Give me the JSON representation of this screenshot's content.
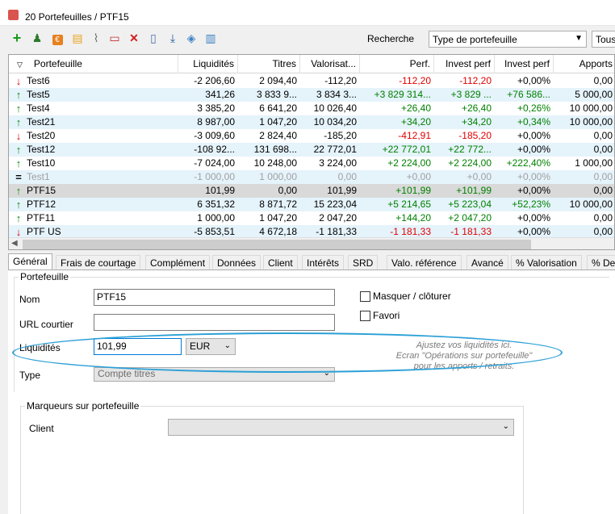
{
  "window": {
    "title": "20 Portefeuilles / PTF15"
  },
  "toolbar": {
    "icons": [
      "add-icon",
      "portfolio-icon",
      "currency-icon",
      "notes-icon",
      "paperclip-icon",
      "calendar-icon",
      "delete-icon",
      "document-icon",
      "download-icon",
      "bag-icon",
      "clipboard-icon"
    ],
    "search_label": "Recherche",
    "type_select": "Type de portefeuille",
    "tous_select": "Tous"
  },
  "grid": {
    "columns": [
      "Portefeuille",
      "Liquidités",
      "Titres",
      "Valorisat...",
      "Perf.",
      "Invest perf",
      "Invest perf",
      "Apports"
    ],
    "rows": [
      {
        "trend": "down",
        "name": "Test6",
        "cells": [
          "-2 206,60",
          "2 094,40",
          "-112,20",
          "-112,20",
          "-112,20",
          "+0,00%",
          "0,00"
        ],
        "colors": [
          "",
          "",
          "",
          "neg",
          "neg",
          "",
          ""
        ]
      },
      {
        "trend": "up",
        "name": "Test5",
        "cells": [
          "341,26",
          "3 833 9...",
          "3 834 3...",
          "+3 829 314...",
          "+3 829 ...",
          "+76 586...",
          "5 000,00"
        ],
        "colors": [
          "",
          "",
          "",
          "pos",
          "pos",
          "pos",
          ""
        ]
      },
      {
        "trend": "up",
        "name": "Test4",
        "cells": [
          "3 385,20",
          "6 641,20",
          "10 026,40",
          "+26,40",
          "+26,40",
          "+0,26%",
          "10 000,00"
        ],
        "colors": [
          "",
          "",
          "",
          "pos",
          "pos",
          "pos",
          ""
        ]
      },
      {
        "trend": "up",
        "name": "Test21",
        "cells": [
          "8 987,00",
          "1 047,20",
          "10 034,20",
          "+34,20",
          "+34,20",
          "+0,34%",
          "10 000,00"
        ],
        "colors": [
          "",
          "",
          "",
          "pos",
          "pos",
          "pos",
          ""
        ]
      },
      {
        "trend": "down",
        "name": "Test20",
        "cells": [
          "-3 009,60",
          "2 824,40",
          "-185,20",
          "-412,91",
          "-185,20",
          "+0,00%",
          "0,00"
        ],
        "colors": [
          "",
          "",
          "",
          "neg",
          "neg",
          "",
          ""
        ]
      },
      {
        "trend": "up",
        "name": "Test12",
        "cells": [
          "-108 92...",
          "131 698...",
          "22 772,01",
          "+22 772,01",
          "+22 772...",
          "+0,00%",
          "0,00"
        ],
        "colors": [
          "",
          "",
          "",
          "pos",
          "pos",
          "",
          ""
        ]
      },
      {
        "trend": "up",
        "name": "Test10",
        "cells": [
          "-7 024,00",
          "10 248,00",
          "3 224,00",
          "+2 224,00",
          "+2 224,00",
          "+222,40%",
          "1 000,00"
        ],
        "colors": [
          "",
          "",
          "",
          "pos",
          "pos",
          "pos",
          ""
        ]
      },
      {
        "trend": "flat",
        "name": "Test1",
        "cells": [
          "-1 000,00",
          "1 000,00",
          "0,00",
          "+0,00",
          "+0,00",
          "+0,00%",
          "0,00"
        ],
        "colors": [
          "gray",
          "gray",
          "gray",
          "gray",
          "gray",
          "gray",
          "gray"
        ]
      },
      {
        "trend": "up",
        "name": "PTF15",
        "cells": [
          "101,99",
          "0,00",
          "101,99",
          "+101,99",
          "+101,99",
          "+0,00%",
          "0,00"
        ],
        "colors": [
          "",
          "",
          "",
          "pos",
          "pos",
          "",
          ""
        ]
      },
      {
        "trend": "up",
        "name": "PTF12",
        "cells": [
          "6 351,32",
          "8 871,72",
          "15 223,04",
          "+5 214,65",
          "+5 223,04",
          "+52,23%",
          "10 000,00"
        ],
        "colors": [
          "",
          "",
          "",
          "pos",
          "pos",
          "pos",
          ""
        ]
      },
      {
        "trend": "up",
        "name": "PTF11",
        "cells": [
          "1 000,00",
          "1 047,20",
          "2 047,20",
          "+144,20",
          "+2 047,20",
          "+0,00%",
          "0,00"
        ],
        "colors": [
          "",
          "",
          "",
          "pos",
          "pos",
          "",
          ""
        ]
      },
      {
        "trend": "down",
        "name": "PTF US",
        "cells": [
          "-5 853,51",
          "4 672,18",
          "-1 181,33",
          "-1 181,33",
          "-1 181,33",
          "+0,00%",
          "0,00"
        ],
        "colors": [
          "",
          "",
          "",
          "neg",
          "neg",
          "",
          ""
        ]
      }
    ],
    "selected_index": 8
  },
  "tabs": [
    "Général",
    "Frais de courtage",
    "Complément",
    "Données",
    "Client",
    "Intérêts",
    "SRD",
    "Valo. référence",
    "Avancé",
    "% Valorisation",
    "% De"
  ],
  "form": {
    "group_title": "Portefeuille",
    "nom_label": "Nom",
    "nom_value": "PTF15",
    "url_label": "URL courtier",
    "url_value": "",
    "liquidites_label": "Liquidités",
    "liquidites_value": "101,99",
    "currency": "EUR",
    "type_label": "Type",
    "type_value": "Compte titres",
    "masquer_label": "Masquer / clôturer",
    "favori_label": "Favori",
    "hint_line1": "Ajustez vos liquidités ici.",
    "hint_line2": "Ecran \"Opérations sur portefeuille\"",
    "hint_line3": "pour les apports / retraits.",
    "marqueurs_title": "Marqueurs sur portefeuille",
    "client_label": "Client",
    "client_value": ""
  }
}
